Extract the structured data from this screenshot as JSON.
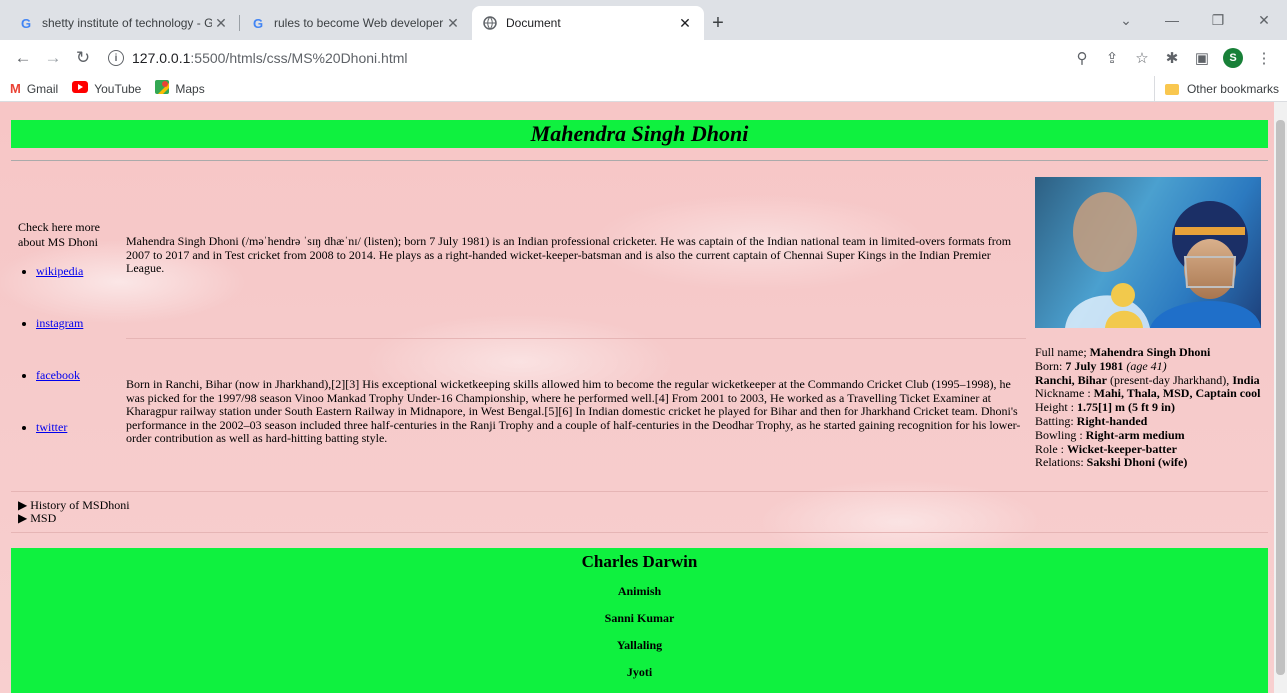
{
  "browser": {
    "tabs": [
      {
        "title": "shetty institute of technology - G",
        "icon": "google-icon",
        "active": false
      },
      {
        "title": "rules to become Web developer",
        "icon": "google-icon",
        "active": false
      },
      {
        "title": "Document",
        "icon": "globe-icon",
        "active": true
      }
    ],
    "address_host": "127.0.0.1",
    "address_path": ":5500/htmls/css/MS%20Dhoni.html",
    "bookmarks": [
      "Gmail",
      "YouTube",
      "Maps"
    ],
    "other_bookmarks": "Other bookmarks",
    "profile_initial": "S"
  },
  "page": {
    "title": "Mahendra Singh Dhoni",
    "sidebar_intro": "Check here more about MS Dhoni",
    "links": [
      "wikipedia",
      "instagram",
      "facebook",
      "twitter"
    ],
    "para1": "Mahendra Singh Dhoni (/məˈhendrə ˈsɪŋ dhæˈnɪ/ (listen); born 7 July 1981) is an Indian professional cricketer. He was captain of the Indian national team in limited-overs formats from 2007 to 2017 and in Test cricket from 2008 to 2014. He plays as a right-handed wicket-keeper-batsman and is also the current captain of Chennai Super Kings in the Indian Premier League.",
    "para2": "Born in Ranchi, Bihar (now in Jharkhand),[2][3] His exceptional wicketkeeping skills allowed him to become the regular wicketkeeper at the Commando Cricket Club (1995–1998), he was picked for the 1997/98 season Vinoo Mankad Trophy Under-16 Championship, where he performed well.[4] From 2001 to 2003, He worked as a Travelling Ticket Examiner at Kharagpur railway station under South Eastern Railway in Midnapore, in West Bengal.[5][6] In Indian domestic cricket he played for Bihar and then for Jharkhand Cricket team. Dhoni's performance in the 2002–03 season included three half-centuries in the Ranji Trophy and a couple of half-centuries in the Deodhar Trophy, as he started gaining recognition for his lower-order contribution as well as hard-hitting batting style.",
    "facts": {
      "fullname_label": "Full name; ",
      "fullname": "Mahendra Singh Dhoni",
      "born_label": "Born: ",
      "born": "7 July 1981",
      "age": "(age 41)",
      "place": "Ranchi, Bihar",
      "place_note": " (present-day Jharkhand), ",
      "country": "India",
      "nickname_label": "Nickname : ",
      "nickname": "Mahi, Thala, MSD, Captain cool",
      "height_label": "Height : ",
      "height": "1.75[1] m (5 ft 9 in)",
      "batting_label": "Batting: ",
      "batting": "Right-handed",
      "bowling_label": "Bowling : ",
      "bowling": "Right-arm medium",
      "role_label": "Role : ",
      "role": "Wicket-keeper-batter",
      "relations_label": "Relations: ",
      "relations": "Sakshi Dhoni (wife)"
    },
    "details": [
      "History of MSDhoni",
      "MSD"
    ],
    "footer_title": "Charles Darwin",
    "footer_names": [
      "Animish",
      "Sanni Kumar",
      "Yallaling",
      "Jyoti"
    ]
  }
}
